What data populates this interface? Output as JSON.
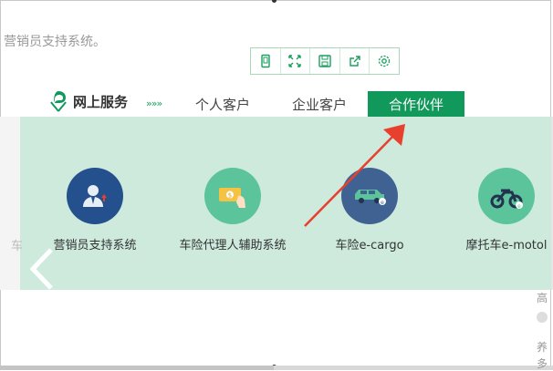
{
  "background_text": "营销员支持系统。",
  "toolbar": {
    "buttons": [
      {
        "name": "mobile-icon"
      },
      {
        "name": "fullscreen-icon"
      },
      {
        "name": "save-icon"
      },
      {
        "name": "share-icon"
      },
      {
        "name": "settings-icon"
      }
    ]
  },
  "header": {
    "logo_text": "网上服务",
    "chevrons": "»»»",
    "nav": [
      "个人客户",
      "企业客户",
      "合作伙伴"
    ],
    "active_index": 2
  },
  "services": [
    {
      "label": "营销员支持系统",
      "icon": "agent-user-icon",
      "color": "#24518e"
    },
    {
      "label": "车险代理人辅助系统",
      "icon": "card-hand-icon",
      "color": "#5cc49a"
    },
    {
      "label": "车险e-cargo",
      "icon": "car-icon",
      "color": "#3f6292"
    },
    {
      "label": "摩托车e-motol",
      "icon": "motorcycle-icon",
      "color": "#5cc49a"
    }
  ],
  "fragments": {
    "left_char": "车",
    "right_chars": [
      "高",
      "养",
      "多"
    ]
  },
  "colors": {
    "accent": "#11995b",
    "panel": "#cdeadd",
    "annotation": "#e8402e"
  }
}
